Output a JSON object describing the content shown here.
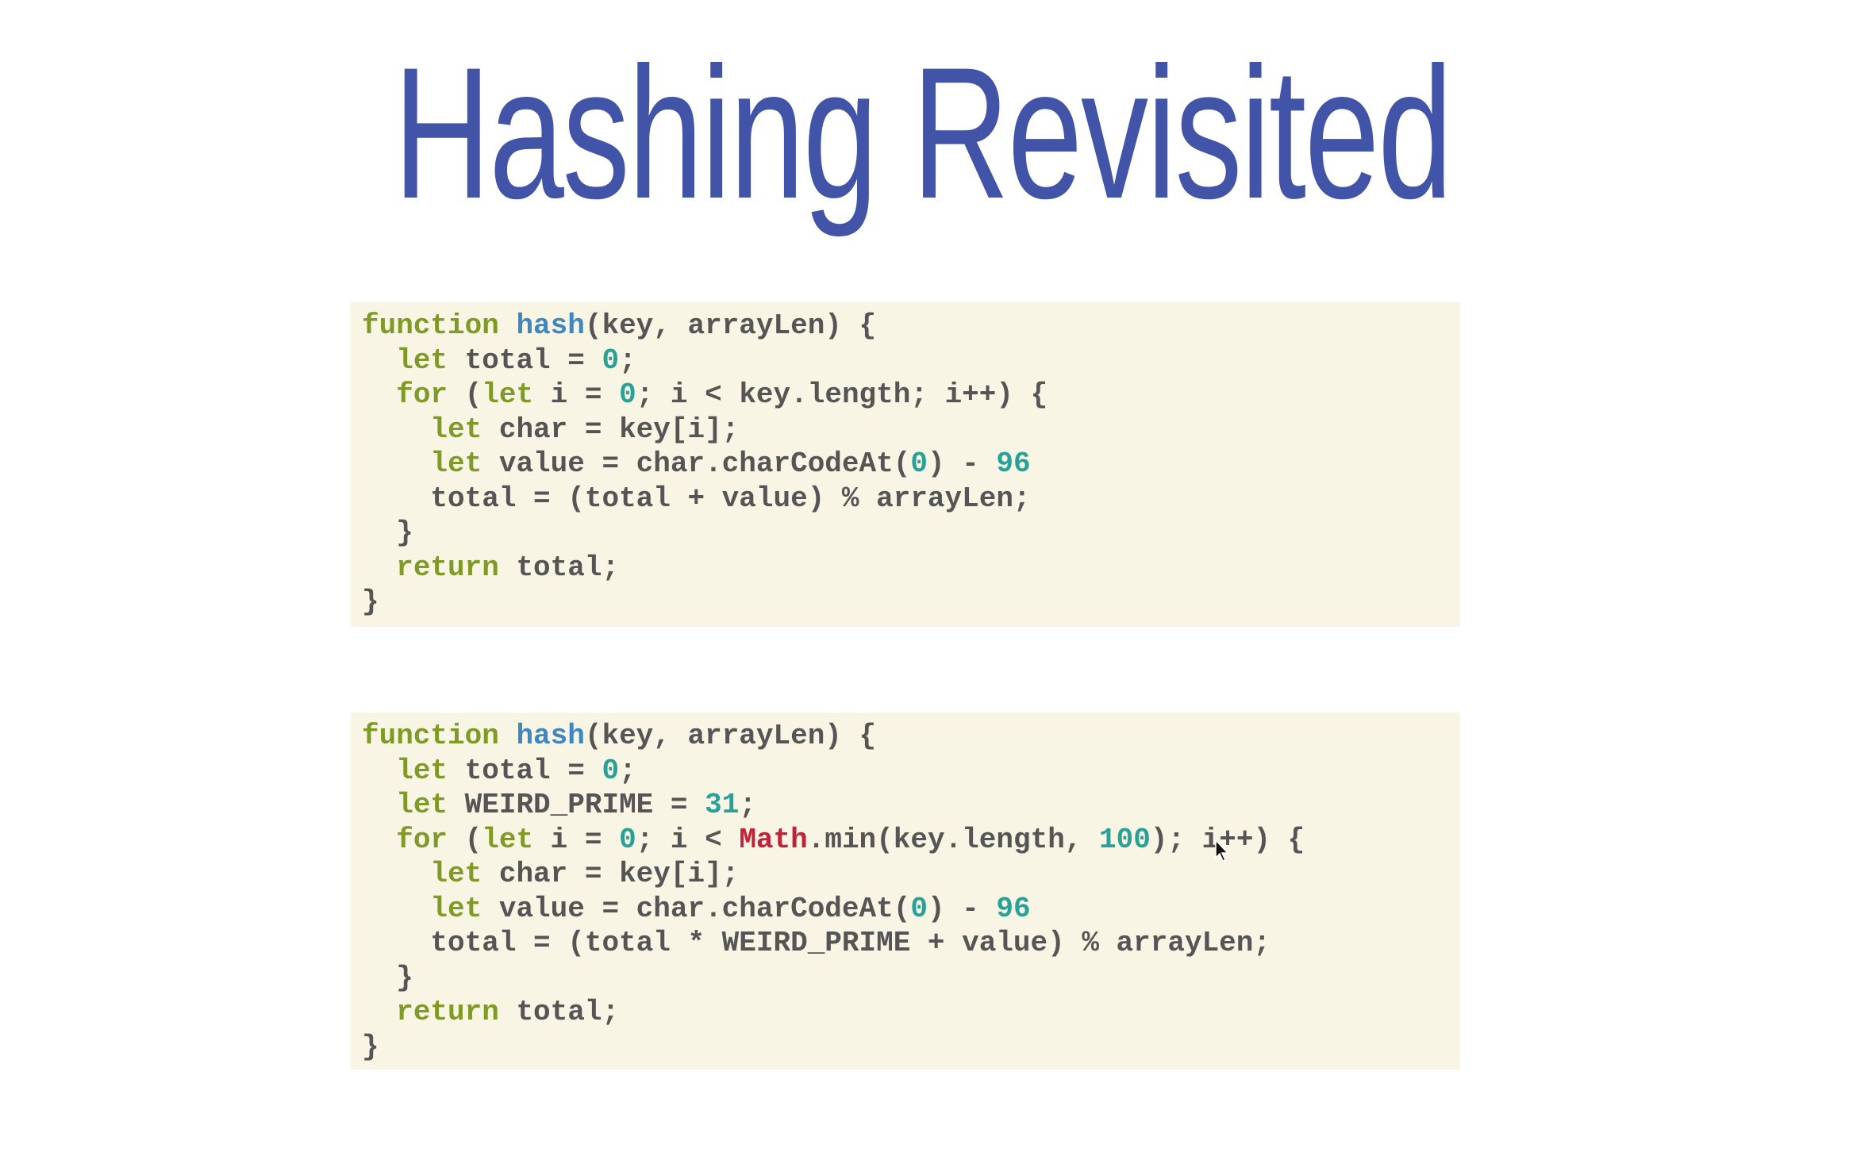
{
  "title": "Hashing Revisited",
  "colors": {
    "title": "#4254a8",
    "code_background": "#f8f5e4",
    "keyword": "#7f9a26",
    "function_name": "#3f87c0",
    "number": "#2aa198",
    "builtin": "#c0223a",
    "plain": "#555555"
  },
  "code_blocks": [
    {
      "lines": [
        [
          [
            "kw",
            "function"
          ],
          [
            "pl",
            " "
          ],
          [
            "fn",
            "hash"
          ],
          [
            "pl",
            "(key, arrayLen) {"
          ]
        ],
        [
          [
            "pl",
            "  "
          ],
          [
            "kw",
            "let"
          ],
          [
            "pl",
            " total = "
          ],
          [
            "num",
            "0"
          ],
          [
            "pl",
            ";"
          ]
        ],
        [
          [
            "pl",
            "  "
          ],
          [
            "kw",
            "for"
          ],
          [
            "pl",
            " ("
          ],
          [
            "kw",
            "let"
          ],
          [
            "pl",
            " i = "
          ],
          [
            "num",
            "0"
          ],
          [
            "pl",
            "; i < key.length; i++) {"
          ]
        ],
        [
          [
            "pl",
            "    "
          ],
          [
            "kw",
            "let"
          ],
          [
            "pl",
            " char = key[i];"
          ]
        ],
        [
          [
            "pl",
            "    "
          ],
          [
            "kw",
            "let"
          ],
          [
            "pl",
            " value = char.charCodeAt("
          ],
          [
            "num",
            "0"
          ],
          [
            "pl",
            ") - "
          ],
          [
            "num",
            "96"
          ]
        ],
        [
          [
            "pl",
            "    total = (total + value) % arrayLen;"
          ]
        ],
        [
          [
            "pl",
            "  }"
          ]
        ],
        [
          [
            "pl",
            "  "
          ],
          [
            "kw",
            "return"
          ],
          [
            "pl",
            " total;"
          ]
        ],
        [
          [
            "pl",
            "}"
          ]
        ]
      ]
    },
    {
      "lines": [
        [
          [
            "kw",
            "function"
          ],
          [
            "pl",
            " "
          ],
          [
            "fn",
            "hash"
          ],
          [
            "pl",
            "(key, arrayLen) {"
          ]
        ],
        [
          [
            "pl",
            "  "
          ],
          [
            "kw",
            "let"
          ],
          [
            "pl",
            " total = "
          ],
          [
            "num",
            "0"
          ],
          [
            "pl",
            ";"
          ]
        ],
        [
          [
            "pl",
            "  "
          ],
          [
            "kw",
            "let"
          ],
          [
            "pl",
            " WEIRD_PRIME = "
          ],
          [
            "num",
            "31"
          ],
          [
            "pl",
            ";"
          ]
        ],
        [
          [
            "pl",
            "  "
          ],
          [
            "kw",
            "for"
          ],
          [
            "pl",
            " ("
          ],
          [
            "kw",
            "let"
          ],
          [
            "pl",
            " i = "
          ],
          [
            "num",
            "0"
          ],
          [
            "pl",
            "; i < "
          ],
          [
            "builtin",
            "Math"
          ],
          [
            "pl",
            ".min(key.length, "
          ],
          [
            "num",
            "100"
          ],
          [
            "pl",
            "); i++) {"
          ]
        ],
        [
          [
            "pl",
            "    "
          ],
          [
            "kw",
            "let"
          ],
          [
            "pl",
            " char = key[i];"
          ]
        ],
        [
          [
            "pl",
            "    "
          ],
          [
            "kw",
            "let"
          ],
          [
            "pl",
            " value = char.charCodeAt("
          ],
          [
            "num",
            "0"
          ],
          [
            "pl",
            ") - "
          ],
          [
            "num",
            "96"
          ]
        ],
        [
          [
            "pl",
            "    total = (total * WEIRD_PRIME + value) % arrayLen;"
          ]
        ],
        [
          [
            "pl",
            "  }"
          ]
        ],
        [
          [
            "pl",
            "  "
          ],
          [
            "kw",
            "return"
          ],
          [
            "pl",
            " total;"
          ]
        ],
        [
          [
            "pl",
            "}"
          ]
        ]
      ]
    }
  ],
  "cursor": {
    "icon": "mouse-pointer-icon"
  }
}
